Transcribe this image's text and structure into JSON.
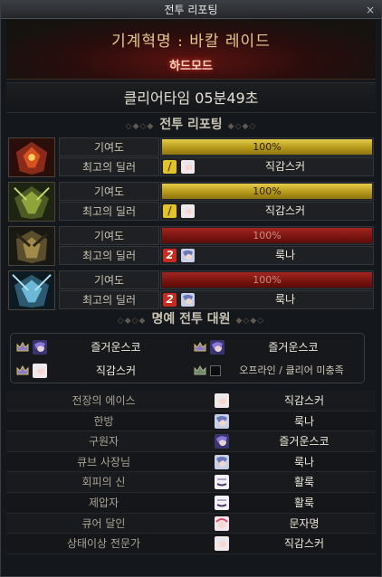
{
  "window": {
    "title": "전투 리포팅",
    "close_label": "×"
  },
  "banner": {
    "dungeon": "기계혁명 : 바칼 레이드",
    "mode": "하드모드"
  },
  "clear_time": "클리어타임   05분49초",
  "sections": {
    "battle_report": "전투 리포팅",
    "honor": "명예 전투 대원"
  },
  "labels": {
    "contribution": "기여도",
    "best_dealer": "최고의 딜러"
  },
  "reports": [
    {
      "boss": "red",
      "contribution": "100%",
      "contribution_value": 100,
      "bar_color": "#b59a1a",
      "rank_badge": "/",
      "dealer": "직감스커"
    },
    {
      "boss": "green",
      "contribution": "100%",
      "contribution_value": 100,
      "bar_color": "#b59a1a",
      "rank_badge": "/",
      "dealer": "직감스커"
    },
    {
      "boss": "gold",
      "contribution": "100%",
      "contribution_value": 100,
      "bar_color": "#7a1410",
      "rank_badge": "2",
      "dealer": "룩나"
    },
    {
      "boss": "blue",
      "contribution": "100%",
      "contribution_value": 100,
      "bar_color": "#7a1410",
      "rank_badge": "2",
      "dealer": "룩나"
    }
  ],
  "honor": [
    {
      "name": "즐거운스코"
    },
    {
      "name": "즐거운스코"
    },
    {
      "name": "직감스커"
    },
    {
      "name": "오프라인 / 클리어 미충족"
    }
  ],
  "awards": [
    {
      "title": "전장의 에이스",
      "player": "직감스커"
    },
    {
      "title": "한방",
      "player": "룩나"
    },
    {
      "title": "구원자",
      "player": "즐거운스코"
    },
    {
      "title": "큐브 사장님",
      "player": "룩나"
    },
    {
      "title": "회피의 신",
      "player": "활룩"
    },
    {
      "title": "제압자",
      "player": "활룩"
    },
    {
      "title": "큐어 달인",
      "player": "문자명"
    },
    {
      "title": "상태이상 전문가",
      "player": "직감스커"
    }
  ]
}
